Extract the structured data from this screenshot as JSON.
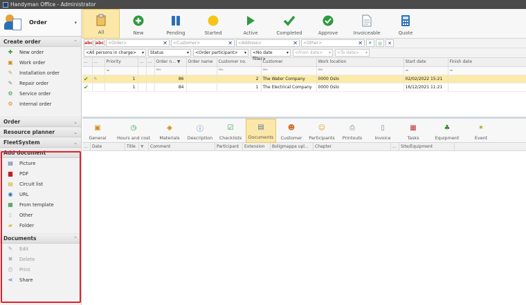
{
  "window": {
    "title": "Handyman Office - Administrator"
  },
  "sidebar": {
    "header": "Order",
    "create_order": {
      "title": "Create order",
      "items": [
        {
          "label": "New order",
          "icon": "plus-icon"
        },
        {
          "label": "Work order",
          "icon": "work-order-icon"
        },
        {
          "label": "Installation order",
          "icon": "installation-icon"
        },
        {
          "label": "Repair order",
          "icon": "wrench-icon"
        },
        {
          "label": "Service order",
          "icon": "service-icon"
        },
        {
          "label": "Internal order",
          "icon": "internal-order-icon"
        }
      ]
    },
    "collapsed_sections": [
      "Order",
      "Resource planner",
      "FleetSystem"
    ],
    "add_document": {
      "title": "Add document",
      "items": [
        {
          "label": "Picture",
          "icon": "picture-icon"
        },
        {
          "label": "PDF",
          "icon": "pdf-icon"
        },
        {
          "label": "Circuit list",
          "icon": "circuit-list-icon"
        },
        {
          "label": "URL",
          "icon": "url-icon"
        },
        {
          "label": "From template",
          "icon": "template-icon"
        },
        {
          "label": "Other",
          "icon": "other-document-icon"
        },
        {
          "label": "Folder",
          "icon": "folder-icon"
        }
      ]
    },
    "documents": {
      "title": "Documents",
      "items": [
        {
          "label": "Edit",
          "icon": "edit-icon"
        },
        {
          "label": "Delete",
          "icon": "delete-icon"
        },
        {
          "label": "Print",
          "icon": "print-icon"
        },
        {
          "label": "Share",
          "icon": "share-icon"
        }
      ]
    }
  },
  "toolbar": {
    "buttons": [
      {
        "label": "All",
        "icon": "clipboard-icon"
      },
      {
        "label": "New",
        "icon": "new-icon"
      },
      {
        "label": "Pending",
        "icon": "pause-icon"
      },
      {
        "label": "Started",
        "icon": "started-icon"
      },
      {
        "label": "Active",
        "icon": "play-icon"
      },
      {
        "label": "Completed",
        "icon": "check-icon"
      },
      {
        "label": "Approve",
        "icon": "approve-icon"
      },
      {
        "label": "Invoiceable",
        "icon": "invoice-doc-icon"
      },
      {
        "label": "Quote",
        "icon": "calculator-icon"
      }
    ]
  },
  "filters": {
    "order_placeholder": "<Order>",
    "customer_placeholder": "<Customer>",
    "address_placeholder": "<Address>",
    "other_placeholder": "<Other>",
    "persons": "<All persons in charge>",
    "status": "Status",
    "participant": "<Order participant>",
    "date_filter": "<No date filter>",
    "from_date": "<From date>",
    "to_date": "<To date>"
  },
  "orders_table": {
    "columns": [
      "...",
      "...",
      "Priority",
      "...",
      "...",
      "Order n...",
      "Order name",
      "Customer no.",
      "Customer",
      "Work location",
      "Start date",
      "Finish date"
    ],
    "rows": [
      {
        "priority": "1",
        "order_no": "86",
        "customer_no": "2",
        "customer": "The Water Company",
        "location": "0000 Oslo",
        "start": "02/02/2022 15:21",
        "finish": ""
      },
      {
        "priority": "1",
        "order_no": "84",
        "customer_no": "1",
        "customer": "The Electrical Company",
        "location": "0000 Oslo",
        "start": "16/12/2021 11:21",
        "finish": ""
      }
    ]
  },
  "detail_tabs": [
    {
      "label": "General",
      "icon": "general-icon"
    },
    {
      "label": "Hours and cost",
      "icon": "hours-icon"
    },
    {
      "label": "Materials",
      "icon": "materials-icon"
    },
    {
      "label": "Description",
      "icon": "info-icon"
    },
    {
      "label": "Checklists",
      "icon": "checklist-icon"
    },
    {
      "label": "Documents",
      "icon": "documents-icon"
    },
    {
      "label": "Customer",
      "icon": "customer-icon"
    },
    {
      "label": "Participants",
      "icon": "participants-icon"
    },
    {
      "label": "Printouts",
      "icon": "printer-icon"
    },
    {
      "label": "Invoice",
      "icon": "invoice-icon"
    },
    {
      "label": "Tasks",
      "icon": "tasks-icon"
    },
    {
      "label": "Equipment",
      "icon": "equipment-icon"
    },
    {
      "label": "Event",
      "icon": "event-icon"
    }
  ],
  "documents_columns": [
    "...",
    "Date",
    "Title",
    "Comment",
    "Participant",
    "Extension",
    "Boligmappa upl...",
    "Chapter",
    "...",
    "Site/Equipment"
  ],
  "colors": {
    "highlight": "#e0202a",
    "selected": "#fbe7a8"
  }
}
